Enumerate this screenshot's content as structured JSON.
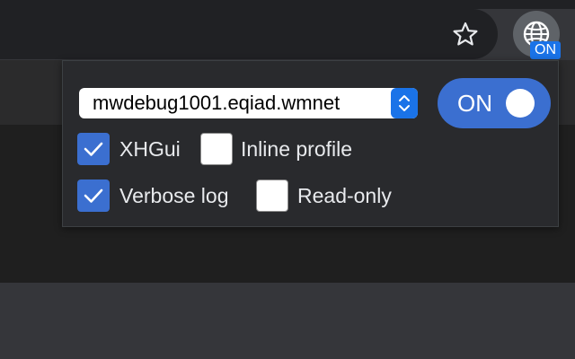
{
  "browser": {
    "star_icon": "star-icon",
    "extension": {
      "icon": "globe-icon",
      "badge": "ON",
      "badge_color": "#1a73e8"
    }
  },
  "popup": {
    "backend": {
      "selected": "mwdebug1001.eqiad.wmnet"
    },
    "toggle": {
      "label": "ON",
      "state": true,
      "color": "#3b6fd0"
    },
    "options": [
      {
        "label": "XHGui",
        "checked": true
      },
      {
        "label": "Inline profile",
        "checked": false
      },
      {
        "label": "Verbose log",
        "checked": true
      },
      {
        "label": "Read-only",
        "checked": false
      }
    ]
  }
}
